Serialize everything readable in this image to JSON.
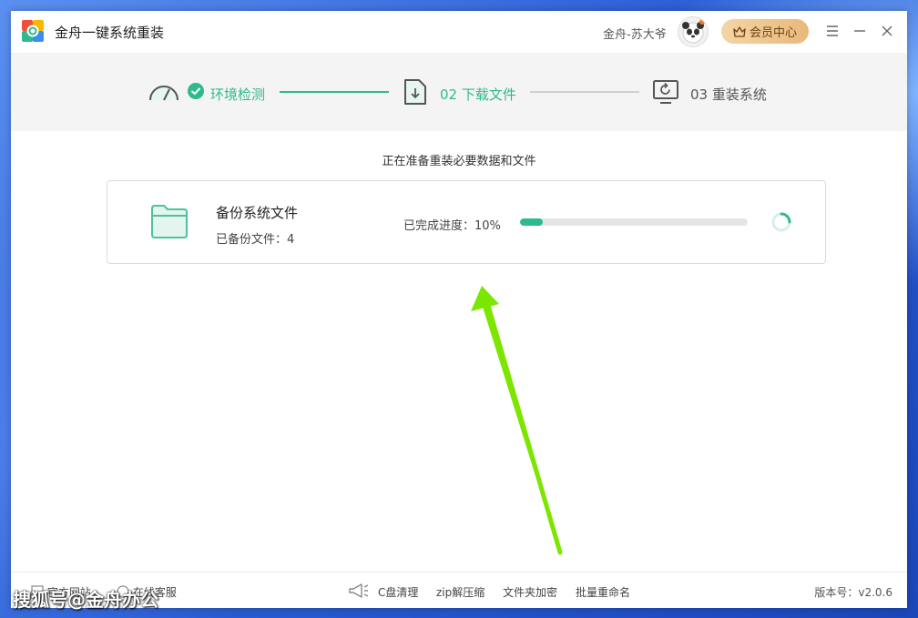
{
  "app": {
    "title": "金舟一键系统重装",
    "user_name": "金舟-苏大爷",
    "vip_label": "会员中心"
  },
  "steps": [
    {
      "label": "环境检测",
      "status": "done"
    },
    {
      "label": "02 下载文件",
      "status": "active"
    },
    {
      "label": "03 重装系统",
      "status": "pending"
    }
  ],
  "main": {
    "subtitle": "正在准备重装必要数据和文件",
    "task_title": "备份系统文件",
    "backed_up_text": "已备份文件：4",
    "progress_text": "已完成进度：10%",
    "progress_value": 0.1
  },
  "footer": {
    "official_site": "官方网站",
    "online_service": "在线客服",
    "tools": [
      "C盘清理",
      "zip解压缩",
      "文件夹加密",
      "批量重命名"
    ],
    "version": "版本号：v2.0.6"
  },
  "watermark": "搜狐号@金舟办公",
  "colors": {
    "accent": "#2fb98f",
    "vip": "#e9b87a",
    "arrow": "#7ce600"
  }
}
